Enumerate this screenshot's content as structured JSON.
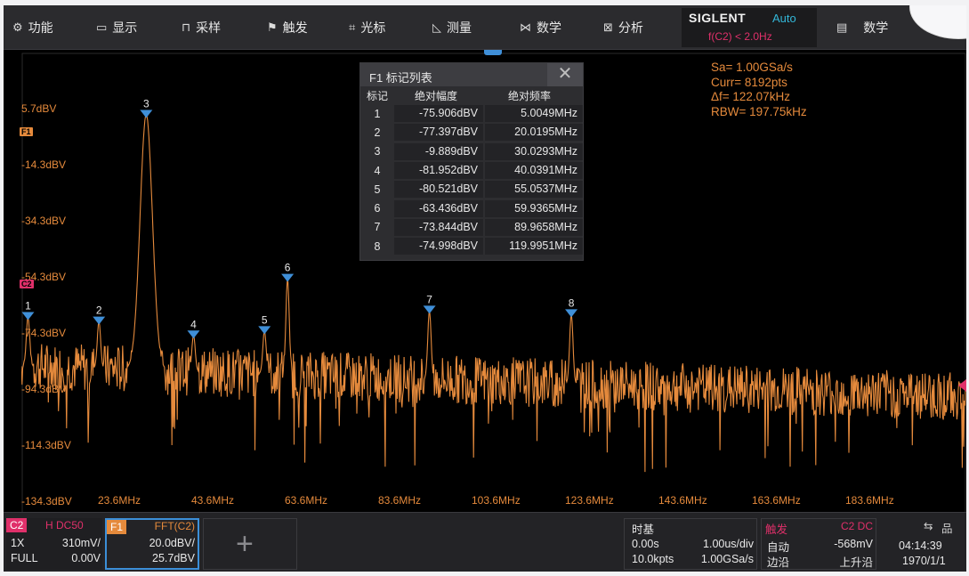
{
  "menu": {
    "items": [
      {
        "icon": "gear-icon",
        "glyph": "⚙",
        "label": "功能"
      },
      {
        "icon": "display-icon",
        "glyph": "▭",
        "label": "显示"
      },
      {
        "icon": "sample-icon",
        "glyph": "⊓",
        "label": "采样"
      },
      {
        "icon": "flag-icon",
        "glyph": "⚑",
        "label": "触发"
      },
      {
        "icon": "cursor-icon",
        "glyph": "⌗",
        "label": "光标"
      },
      {
        "icon": "measure-icon",
        "glyph": "◺",
        "label": "测量"
      },
      {
        "icon": "math-icon",
        "glyph": "⋈",
        "label": "数学"
      },
      {
        "icon": "analyze-icon",
        "glyph": "⊠",
        "label": "分析"
      }
    ],
    "brand": "SIGLENT",
    "acq_mode": "Auto",
    "freq_readout": "f(C2) < 2.0Hz",
    "math2": {
      "icon": "memory-icon",
      "glyph": "▤",
      "label": "数学"
    }
  },
  "info": {
    "sa": "Sa=  1.00GSa/s",
    "curr": "Curr= 8192pts",
    "df": "Δf=  122.07kHz",
    "rbw": "RBW=  197.75kHz"
  },
  "mark_table": {
    "title": "F1 标记列表",
    "close_glyph": "✕",
    "columns": [
      "标记",
      "绝对幅度",
      "绝对频率"
    ],
    "rows": [
      {
        "mark": "1",
        "amp": "-75.906dBV",
        "freq": "5.0049MHz"
      },
      {
        "mark": "2",
        "amp": "-77.397dBV",
        "freq": "20.0195MHz"
      },
      {
        "mark": "3",
        "amp": "-9.889dBV",
        "freq": "30.0293MHz"
      },
      {
        "mark": "4",
        "amp": "-81.952dBV",
        "freq": "40.0391MHz"
      },
      {
        "mark": "5",
        "amp": "-80.521dBV",
        "freq": "55.0537MHz"
      },
      {
        "mark": "6",
        "amp": "-63.436dBV",
        "freq": "59.9365MHz"
      },
      {
        "mark": "7",
        "amp": "-73.844dBV",
        "freq": "89.9658MHz"
      },
      {
        "mark": "8",
        "amp": "-74.998dBV",
        "freq": "119.9951MHz"
      }
    ]
  },
  "channel_tags": {
    "f1": "F1",
    "c2": "C2"
  },
  "chart_data": {
    "type": "line",
    "series_color": "#e58a3c",
    "marker_color": "#3f8fd8",
    "y_ticks": [
      "5.7dBV",
      "-14.3dBV",
      "-34.3dBV",
      "-54.3dBV",
      "-74.3dBV",
      "-94.3dBV",
      "-114.3dBV",
      "-134.3dBV"
    ],
    "x_ticks": [
      "23.6MHz",
      "43.6MHz",
      "63.6MHz",
      "83.6MHz",
      "103.6MHz",
      "123.6MHz",
      "143.6MHz",
      "163.6MHz",
      "183.6MHz"
    ],
    "xlim_MHz": [
      3.6,
      203.6
    ],
    "ylim_dBV": [
      -140.3,
      10.3
    ],
    "noise_floor_dBV": [
      -92,
      -102
    ],
    "peaks": [
      {
        "label": "1",
        "x": 5.0049,
        "y": -75.906
      },
      {
        "label": "2",
        "x": 20.0195,
        "y": -77.397
      },
      {
        "label": "3",
        "x": 30.0293,
        "y": -9.889
      },
      {
        "label": "4",
        "x": 40.0391,
        "y": -81.952
      },
      {
        "label": "5",
        "x": 55.0537,
        "y": -80.521
      },
      {
        "label": "6",
        "x": 59.9365,
        "y": -63.436
      },
      {
        "label": "7",
        "x": 89.9658,
        "y": -73.844
      },
      {
        "label": "8",
        "x": 119.9951,
        "y": -74.998
      }
    ]
  },
  "status": {
    "c2": {
      "name": "C2",
      "coupling": "H  DC50",
      "probe": "1X",
      "scale": "310mV/",
      "bw": "FULL",
      "offset": "0.00V"
    },
    "f1": {
      "name": "F1",
      "src": "FFT(C2)",
      "scale": "20.0dBV/",
      "offset": "25.7dBV"
    },
    "add_glyph": "+",
    "timebase": {
      "title": "时基",
      "delay": "0.00s",
      "scale": "1.00us/div",
      "points": "10.0kpts",
      "rate": "1.00GSa/s"
    },
    "trigger": {
      "title": "触发",
      "src": "C2 DC",
      "mode": "自动",
      "level": "-568mV",
      "type": "边沿",
      "slope": "上升沿"
    },
    "clock": {
      "time": "04:14:39",
      "date": "1970/1/1",
      "usb_glyph": "⇆",
      "net_glyph": "品"
    }
  }
}
